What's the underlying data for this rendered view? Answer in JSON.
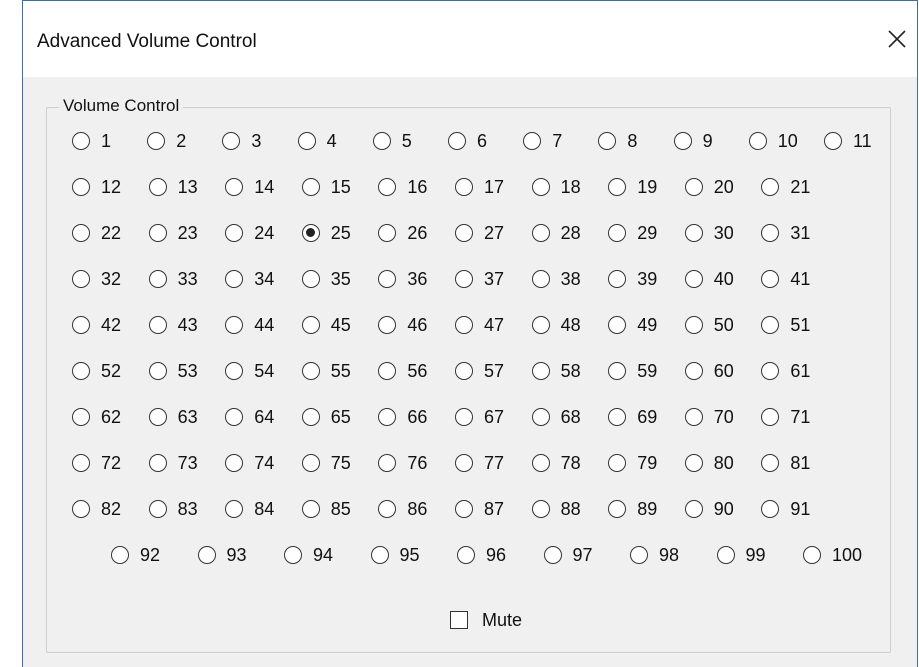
{
  "window": {
    "title": "Advanced Volume Control",
    "close_icon": "close-icon"
  },
  "volume_group": {
    "legend": "Volume Control",
    "selected": 25,
    "options": [
      "1",
      "2",
      "3",
      "4",
      "5",
      "6",
      "7",
      "8",
      "9",
      "10",
      "11",
      "12",
      "13",
      "14",
      "15",
      "16",
      "17",
      "18",
      "19",
      "20",
      "21",
      "22",
      "23",
      "24",
      "25",
      "26",
      "27",
      "28",
      "29",
      "30",
      "31",
      "32",
      "33",
      "34",
      "35",
      "36",
      "37",
      "38",
      "39",
      "40",
      "41",
      "42",
      "43",
      "44",
      "45",
      "46",
      "47",
      "48",
      "49",
      "50",
      "51",
      "52",
      "53",
      "54",
      "55",
      "56",
      "57",
      "58",
      "59",
      "60",
      "61",
      "62",
      "63",
      "64",
      "65",
      "66",
      "67",
      "68",
      "69",
      "70",
      "71",
      "72",
      "73",
      "74",
      "75",
      "76",
      "77",
      "78",
      "79",
      "80",
      "81",
      "82",
      "83",
      "84",
      "85",
      "86",
      "87",
      "88",
      "89",
      "90",
      "91",
      "92",
      "93",
      "94",
      "95",
      "96",
      "97",
      "98",
      "99",
      "100"
    ]
  },
  "mute": {
    "label": "Mute",
    "checked": false
  }
}
